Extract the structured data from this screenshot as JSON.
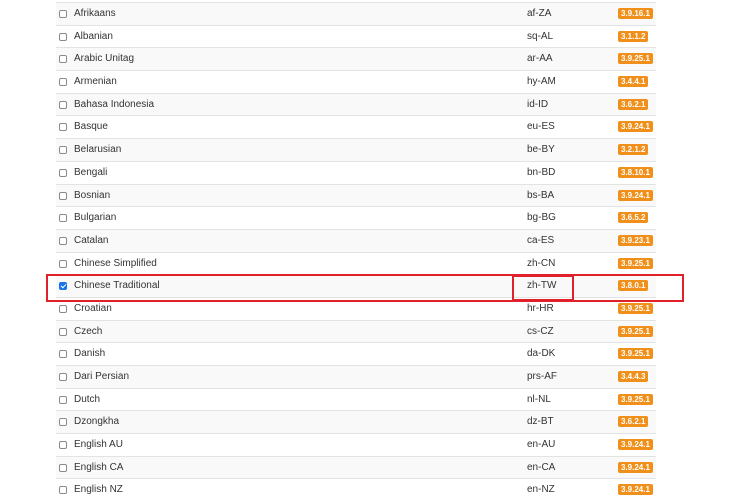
{
  "table": {
    "rows": [
      {
        "name": "Afrikaans",
        "code": "af-ZA",
        "version": "3.9.16.1",
        "checked": false
      },
      {
        "name": "Albanian",
        "code": "sq-AL",
        "version": "3.1.1.2",
        "checked": false
      },
      {
        "name": "Arabic Unitag",
        "code": "ar-AA",
        "version": "3.9.25.1",
        "checked": false
      },
      {
        "name": "Armenian",
        "code": "hy-AM",
        "version": "3.4.4.1",
        "checked": false
      },
      {
        "name": "Bahasa Indonesia",
        "code": "id-ID",
        "version": "3.6.2.1",
        "checked": false
      },
      {
        "name": "Basque",
        "code": "eu-ES",
        "version": "3.9.24.1",
        "checked": false
      },
      {
        "name": "Belarusian",
        "code": "be-BY",
        "version": "3.2.1.2",
        "checked": false
      },
      {
        "name": "Bengali",
        "code": "bn-BD",
        "version": "3.8.10.1",
        "checked": false
      },
      {
        "name": "Bosnian",
        "code": "bs-BA",
        "version": "3.9.24.1",
        "checked": false
      },
      {
        "name": "Bulgarian",
        "code": "bg-BG",
        "version": "3.6.5.2",
        "checked": false
      },
      {
        "name": "Catalan",
        "code": "ca-ES",
        "version": "3.9.23.1",
        "checked": false
      },
      {
        "name": "Chinese Simplified",
        "code": "zh-CN",
        "version": "3.9.25.1",
        "checked": false
      },
      {
        "name": "Chinese Traditional",
        "code": "zh-TW",
        "version": "3.8.0.1",
        "checked": true
      },
      {
        "name": "Croatian",
        "code": "hr-HR",
        "version": "3.9.25.1",
        "checked": false
      },
      {
        "name": "Czech",
        "code": "cs-CZ",
        "version": "3.9.25.1",
        "checked": false
      },
      {
        "name": "Danish",
        "code": "da-DK",
        "version": "3.9.25.1",
        "checked": false
      },
      {
        "name": "Dari Persian",
        "code": "prs-AF",
        "version": "3.4.4.3",
        "checked": false
      },
      {
        "name": "Dutch",
        "code": "nl-NL",
        "version": "3.9.25.1",
        "checked": false
      },
      {
        "name": "Dzongkha",
        "code": "dz-BT",
        "version": "3.6.2.1",
        "checked": false
      },
      {
        "name": "English AU",
        "code": "en-AU",
        "version": "3.9.24.1",
        "checked": false
      },
      {
        "name": "English CA",
        "code": "en-CA",
        "version": "3.9.24.1",
        "checked": false
      },
      {
        "name": "English NZ",
        "code": "en-NZ",
        "version": "3.9.24.1",
        "checked": false
      }
    ]
  },
  "colors": {
    "version_badge": "#f0901a",
    "highlight": "#e0202a",
    "checkbox_checked": "#1a73e8"
  }
}
